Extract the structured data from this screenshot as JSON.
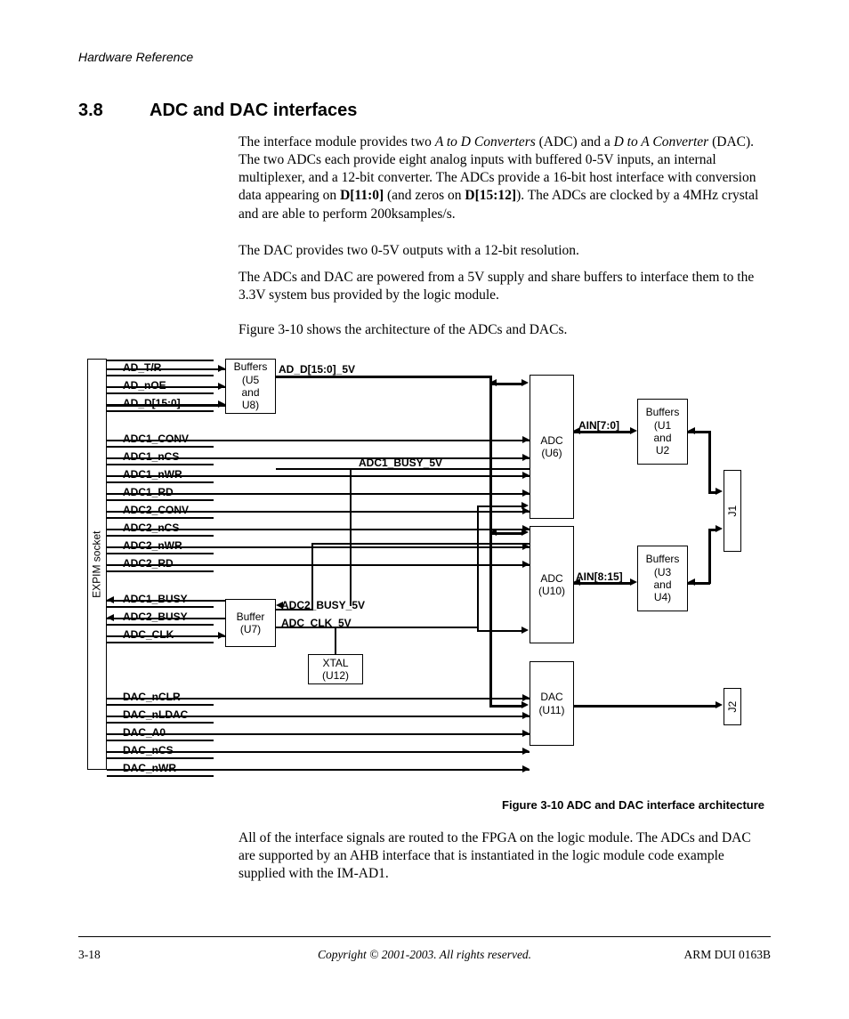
{
  "header": {
    "text": "Hardware Reference"
  },
  "section": {
    "number": "3.8",
    "title": "ADC and DAC interfaces"
  },
  "para1_parts": {
    "a": "The interface module provides two ",
    "b": "A to D Converters",
    "c": " (ADC) and a ",
    "d": "D to A Converter",
    "e": " (DAC). The two ADCs each provide eight analog inputs with buffered 0-5V inputs, an internal multiplexer, and a 12-bit converter. The ADCs provide a 16-bit host interface with conversion data appearing on ",
    "f": "D[11:0]",
    "g": " (and zeros on ",
    "h": "D[15:12]",
    "i": "). The ADCs are clocked by a 4MHz crystal and are able to perform 200ksamples/s."
  },
  "para2": "The DAC provides two 0-5V outputs with a 12-bit resolution.",
  "para3": "The ADCs and DAC are powered from a 5V supply and share buffers to interface them to the 3.3V system bus provided by the logic module.",
  "para4": "Figure 3-10 shows the architecture of the ADCs and DACs.",
  "para5": "All of the interface signals are routed to the FPGA on the logic module. The ADCs and DAC are supported by an AHB interface that is instantiated in the logic module code example supplied with the IM-AD1.",
  "figcaption": "Figure 3-10 ADC and DAC interface architecture",
  "footer": {
    "left": "3-18",
    "center": "Copyright © 2001-2003. All rights reserved.",
    "right": "ARM DUI 0163B"
  },
  "diagram": {
    "socket_label": "EXPIM socket",
    "signals_left": [
      "AD_T/R",
      "AD_nOE",
      "AD_D[15:0]",
      "ADC1_CONV",
      "ADC1_nCS",
      "ADC1_nWR",
      "ADC1_RD",
      "ADC2_CONV",
      "ADC2_nCS",
      "ADC2_nWR",
      "ADC2_RD",
      "ADC1_BUSY",
      "ADC2_BUSY",
      "ADC_CLK",
      "DAC_nCLR",
      "DAC_nLDAC",
      "DAC_A0",
      "DAC_nCS",
      "DAC_nWR"
    ],
    "buffersU5": {
      "l1": "Buffers",
      "l2": "(U5",
      "l3": "and",
      "l4": "U8)"
    },
    "bufferU7": {
      "l1": "Buffer",
      "l2": "(U7)"
    },
    "xtal": {
      "l1": "XTAL",
      "l2": "(U12)"
    },
    "adcU6": {
      "l1": "ADC",
      "l2": "(U6)"
    },
    "adcU10": {
      "l1": "ADC",
      "l2": "(U10)"
    },
    "dacU11": {
      "l1": "DAC",
      "l2": "(U11)"
    },
    "buffersU1": {
      "l1": "Buffers",
      "l2": "(U1",
      "l3": "and",
      "l4": "U2"
    },
    "buffersU3": {
      "l1": "Buffers",
      "l2": "(U3",
      "l3": "and",
      "l4": "U4)"
    },
    "j1": "J1",
    "j2": "J2",
    "mid_labels": {
      "ad_d_5v": "AD_D[15:0]_5V",
      "adc1_busy_5v": "ADC1_BUSY_5V",
      "adc2_busy_5v": "ADC2_BUSY_5V",
      "adc_clk_5v": "ADC_CLK_5V",
      "ain70": "AIN[7:0]",
      "ain815": "AIN[8:15]"
    }
  }
}
